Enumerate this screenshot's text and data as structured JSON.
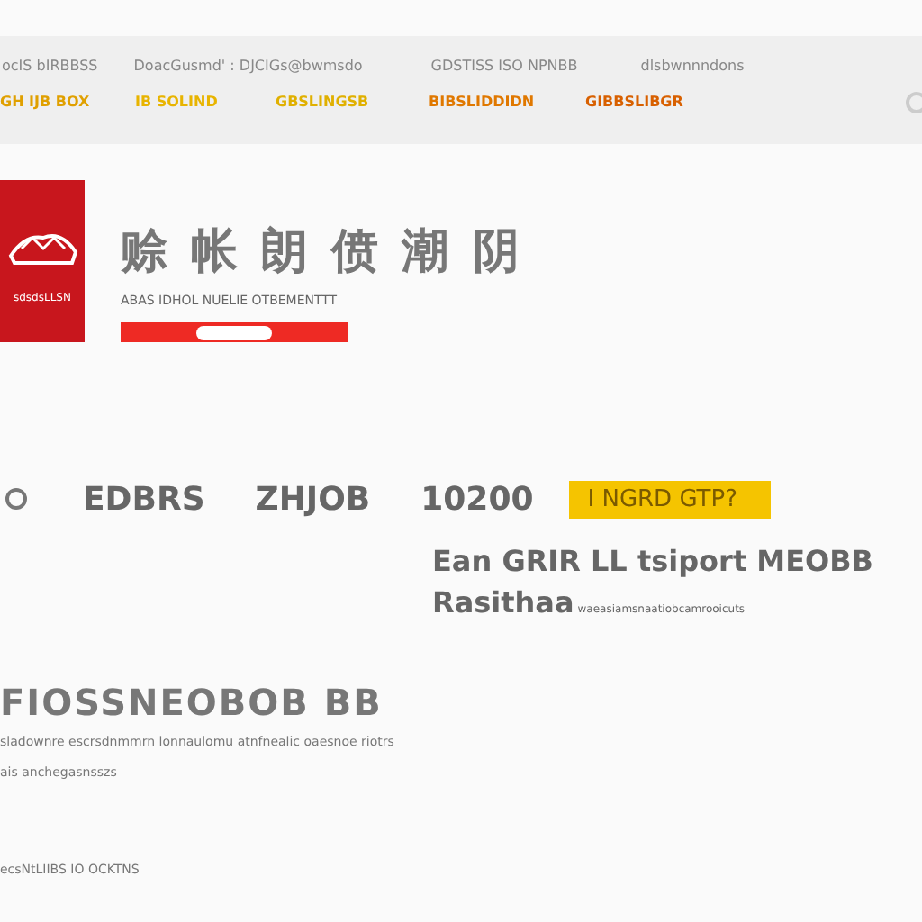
{
  "header": {
    "links": [
      "ocIS bIRBBSS",
      "DoacGusmd' : DJCIGs@bwmsdo",
      "GDSTISS ISO NPNBB",
      "dlsbwnnndons"
    ],
    "tags": [
      {
        "label": "GH IJB BOX",
        "color": "#e0a000"
      },
      {
        "label": "IB SOLIND",
        "color": "#e8b400"
      },
      {
        "label": "GBSLINGSB",
        "color": "#e0b000"
      },
      {
        "label": "BIBSLIDDIDN",
        "color": "#e07800"
      },
      {
        "label": "GIBBSLIBGR",
        "color": "#d86000"
      }
    ]
  },
  "brand": {
    "logo_caption": "sdsdsLLSN",
    "title": "赊 帐 朗 偾 潮 阴",
    "subtitle": "ABAS IDHOL NUELIE OTBEMENTTT"
  },
  "stats": {
    "items": [
      "EDBRS",
      "ZHJOB",
      "10200"
    ],
    "badge": "I NGRD GTP?"
  },
  "details": {
    "line_1": "Ean GRIR LL tsiport  MEOBB",
    "line_2_strong": "Rasithaa",
    "line_2_note": "waeasiamsnaatiobcamrooicuts"
  },
  "section": {
    "heading": "FIOSSNEOBOB BB",
    "text": "sladownre escrsdnmmrn lonnaulomu atnfnealic oaesnoe riotrs",
    "note": "ais anchegasnsszs",
    "footer": "ecsNtLIIBS IO OCKTNS"
  }
}
